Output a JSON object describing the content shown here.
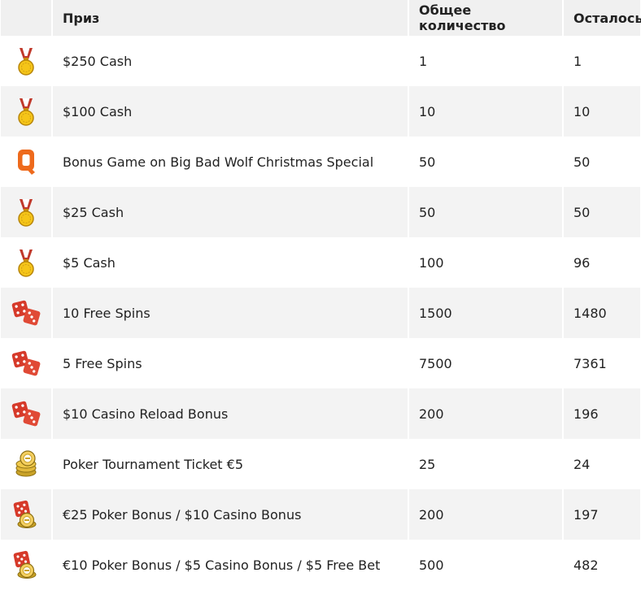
{
  "table": {
    "headers": {
      "prize": "Приз",
      "total": "Общее количество",
      "left": "Осталось"
    },
    "rows": [
      {
        "icon": "medal-icon",
        "prize": "$250 Cash",
        "total": "1",
        "left": "1"
      },
      {
        "icon": "medal-icon",
        "prize": "$100 Cash",
        "total": "10",
        "left": "10"
      },
      {
        "icon": "q-logo-icon",
        "prize": "Bonus Game on Big Bad Wolf Christmas Special",
        "total": "50",
        "left": "50"
      },
      {
        "icon": "medal-icon",
        "prize": "$25 Cash",
        "total": "50",
        "left": "50"
      },
      {
        "icon": "medal-icon",
        "prize": "$5 Cash",
        "total": "100",
        "left": "96"
      },
      {
        "icon": "dice-icon",
        "prize": "10 Free Spins",
        "total": "1500",
        "left": "1480"
      },
      {
        "icon": "dice-icon",
        "prize": "5 Free Spins",
        "total": "7500",
        "left": "7361"
      },
      {
        "icon": "dice-icon",
        "prize": "$10 Casino Reload Bonus",
        "total": "200",
        "left": "196"
      },
      {
        "icon": "poker-chips-icon",
        "prize": "Poker Tournament Ticket €5",
        "total": "25",
        "left": "24"
      },
      {
        "icon": "dice-chip-icon",
        "prize": "€25 Poker Bonus / $10 Casino Bonus",
        "total": "200",
        "left": "197"
      },
      {
        "icon": "dice-chip-icon",
        "prize": "€10 Poker Bonus / $5 Casino Bonus / $5 Free Bet",
        "total": "500",
        "left": "482"
      }
    ]
  }
}
